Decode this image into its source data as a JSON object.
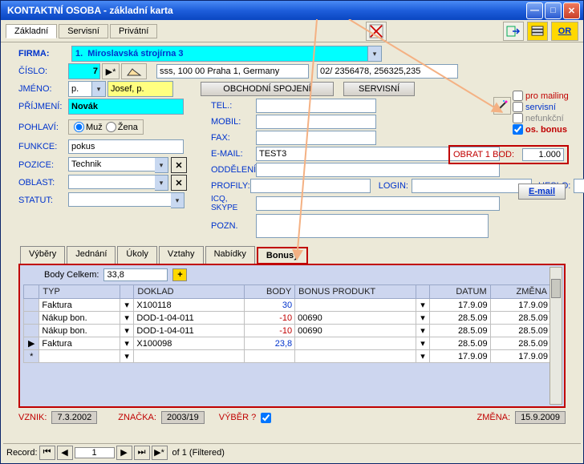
{
  "window": {
    "title": "KONTAKTNÍ OSOBA - základní karta"
  },
  "topTabs": {
    "zakladni": "Základní",
    "servisni": "Servisní",
    "privatni": "Privátní"
  },
  "orBtn": "OR",
  "labels": {
    "firma": "FIRMA:",
    "cislo": "ČÍSLO:",
    "jmeno": "JMÉNO:",
    "prijmeni": "PŘÍJMENÍ:",
    "pohlavi": "POHLAVÍ:",
    "funkce": "FUNKCE:",
    "pozice": "POZICE:",
    "oblast": "OBLAST:",
    "statut": "STATUT:",
    "tel": "TEL.:",
    "mobil": "MOBIL:",
    "fax": "FAX:",
    "email": "E-MAIL:",
    "oddeleni": "ODDĚLENÍ:",
    "profily": "PROFILY:",
    "login": "LOGIN:",
    "heslo": "HESLO:",
    "icq": "ICQ, SKYPE",
    "pozn": "POZN.",
    "muz": "Muž",
    "zena": "Žena"
  },
  "buttons": {
    "obchspoj": "OBCHODNÍ SPOJENÍ",
    "servisni": "SERVISNÍ",
    "emailBtn": "E-mail"
  },
  "values": {
    "firma": "1.  Miroslavská strojírna 3",
    "cislo": "7",
    "address": "sss, 100 00 Praha 1, Germany",
    "phone": "02/ 2356478, 256325,235",
    "jm_p": "p.",
    "jm_name": "Josef, p.",
    "prijmeni": "Novák",
    "pohlavi": "muz",
    "funkce": "pokus",
    "pozice": "Technik",
    "oblast": "",
    "statut": "",
    "tel": "",
    "mobil": "",
    "fax": "",
    "email": "TEST3",
    "oddeleni": "",
    "profily": "",
    "login": "",
    "heslo": "",
    "icq": "",
    "pozn": ""
  },
  "flags": {
    "mailing": "pro mailing",
    "servisni": "servisní",
    "nefunkcni": "nefunkční",
    "osbonus": "os. bonus",
    "osbonus_checked": true
  },
  "obrat": {
    "label": "OBRAT 1 BOD:",
    "value": "1.000"
  },
  "tabs2": {
    "vybery": "Výběry",
    "jednani": "Jednání",
    "ukoly": "Úkoly",
    "vztahy": "Vztahy",
    "nabidky": "Nabídky",
    "bonusy": "Bonusy"
  },
  "grid": {
    "bodyCelkemLabel": "Body Celkem:",
    "bodyCelkemVal": "33,8",
    "hdr": {
      "typ": "TYP",
      "doklad": "DOKLAD",
      "body": "BODY",
      "produkt": "BONUS PRODUKT",
      "datum": "DATUM",
      "zmena": "ZMĚNA"
    },
    "rows": [
      {
        "typ": "Faktura",
        "doklad": "X100118",
        "body": "30",
        "bodyneg": false,
        "produkt": "",
        "datum": "17.9.09",
        "zmena": "17.9.09"
      },
      {
        "typ": "Nákup bon.",
        "doklad": "DOD-1-04-011",
        "body": "-10",
        "bodyneg": true,
        "produkt": "00690",
        "datum": "28.5.09",
        "zmena": "28.5.09"
      },
      {
        "typ": "Nákup bon.",
        "doklad": "DOD-1-04-011",
        "body": "-10",
        "bodyneg": true,
        "produkt": "00690",
        "datum": "28.5.09",
        "zmena": "28.5.09"
      },
      {
        "typ": "Faktura",
        "doklad": "X100098",
        "body": "23,8",
        "bodyneg": false,
        "produkt": "",
        "datum": "28.5.09",
        "zmena": "28.5.09"
      },
      {
        "typ": "",
        "doklad": "",
        "body": "",
        "bodyneg": false,
        "produkt": "",
        "datum": "17.9.09",
        "zmena": "17.9.09"
      }
    ],
    "rowmark": [
      "",
      "",
      "",
      "▶",
      "*"
    ]
  },
  "bottom": {
    "vznikL": "VZNIK:",
    "vznikV": "7.3.2002",
    "znackaL": "ZNAČKA:",
    "znackaV": "2003/19",
    "vyberL": "VÝBĚR ?",
    "zmenaL": "ZMĚNA:",
    "zmenaV": "15.9.2009"
  },
  "recbar": {
    "label": "Record:",
    "value": "1",
    "of": "of  1 (Filtered)"
  }
}
